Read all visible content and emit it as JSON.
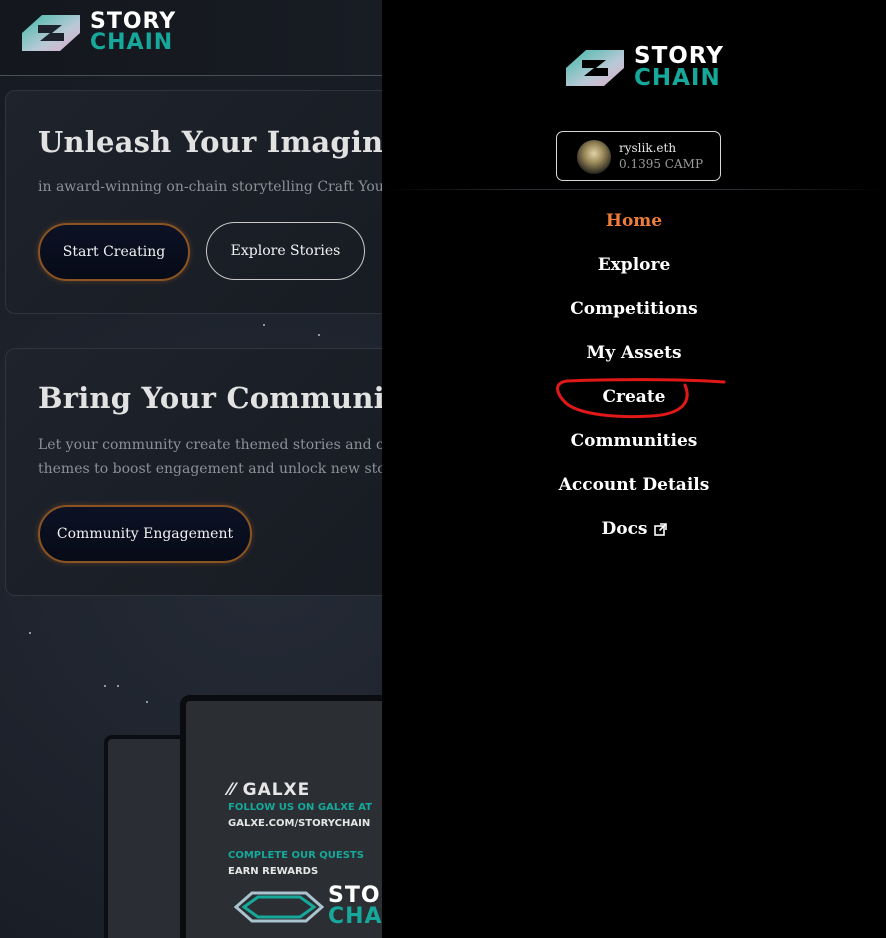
{
  "brand": {
    "word1": "STORY",
    "word2": "CHAIN"
  },
  "hero": {
    "title": "Unleash Your Imagination",
    "text": "in award-winning on-chain storytelling Craft Your Tale, Ch",
    "start_button": "Start Creating",
    "explore_button": "Explore Stories"
  },
  "community": {
    "title": "Bring Your Community to I",
    "text_line1": "Let your community create themed stories and comics dir",
    "text_line2": "themes to boost engagement and unlock new storytelling e",
    "button": "Community Engagement"
  },
  "promo": {
    "galxe": "GALXE",
    "line1": "FOLLOW US ON GALXE AT",
    "line2": "GALXE.COM/STORYCHAIN",
    "line3": "COMPLETE OUR QUESTS",
    "line4": "EARN REWARDS",
    "logo_word1": "STOR",
    "logo_word2": "CHAI"
  },
  "wallet": {
    "name": "ryslik.eth",
    "balance": "0.1395 CAMP"
  },
  "nav": {
    "items": [
      {
        "label": "Home",
        "active": true
      },
      {
        "label": "Explore"
      },
      {
        "label": "Competitions"
      },
      {
        "label": "My Assets"
      },
      {
        "label": "Create",
        "annotated": true
      },
      {
        "label": "Communities"
      },
      {
        "label": "Account Details"
      },
      {
        "label": "Docs",
        "icon": "external-link-icon"
      }
    ]
  },
  "colors": {
    "accent": "#ee7d3a",
    "brand_teal": "#16a89a",
    "annotation": "#e01818",
    "drawer_bg": "#000000"
  }
}
